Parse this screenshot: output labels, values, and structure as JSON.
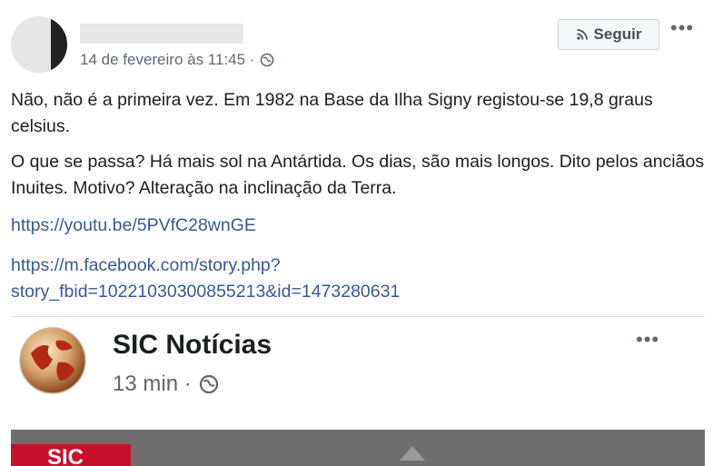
{
  "post": {
    "timestamp": "14 de fevereiro às 11:45 ·",
    "follow_label": "Seguir",
    "more_label": "•••",
    "paragraph1": "Não, não é a primeira vez. Em 1982 na Base da Ilha Signy registou-se 19,8 graus celsius.",
    "paragraph2": "O que se passa? Há mais sol na Antártida. Os dias, são mais longos. Dito pelos anciãos Inuites. Motivo? Alteração na inclinação da Terra.",
    "link1": "https://youtu.be/5PVfC28wnGE",
    "link2_line1": "https://m.facebook.com/story.php?",
    "link2_line2": "story_fbid=10221030300855213&id=1473280631"
  },
  "shared_post": {
    "page_name": "SIC Notícias",
    "time": "13 min ·",
    "more_label": "•••",
    "media_badge": "SIC"
  },
  "colors": {
    "link": "#385898",
    "secondary_text": "#606770",
    "brand_red": "#c8102e"
  },
  "icons": {
    "rss": "rss-icon",
    "globe": "globe-icon",
    "logo": "sic-globe-logo"
  }
}
